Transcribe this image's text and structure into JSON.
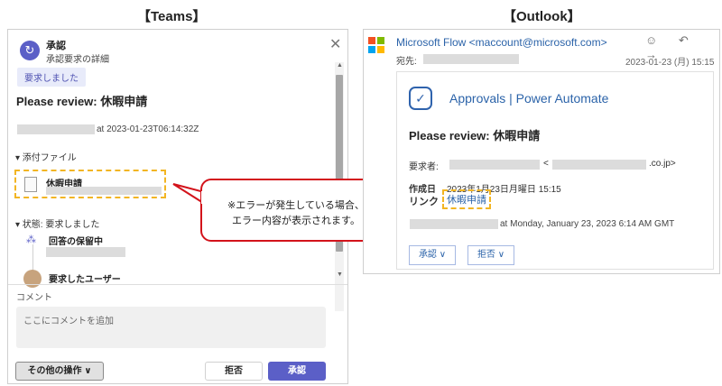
{
  "headings": {
    "teams": "【Teams】",
    "outlook": "【Outlook】"
  },
  "teams": {
    "app_icon": "approval-icon",
    "title": "承認",
    "subtitle": "承認要求の詳細",
    "close": "✕",
    "status_badge": "要求しました",
    "review_title": "Please review: 休暇申請",
    "timestamp": "at 2023-01-23T06:14:32Z",
    "attachments_header": "▾ 添付ファイル",
    "attachment_name": "休暇申請",
    "status_header": "▾ 状態: 要求しました",
    "pending_label": "回答の保留中",
    "requester_label": "要求したユーザー",
    "comment_label": "コメント",
    "comment_placeholder": "ここにコメントを追加",
    "other_actions": "その他の操作 ∨",
    "reject": "拒否",
    "approve": "承認",
    "accent_color": "#5b5fc7"
  },
  "callout": {
    "line1": "※エラーが発生している場合、",
    "line2": "エラー内容が表示されます。",
    "border_color": "#d3131b"
  },
  "outlook": {
    "from": "Microsoft Flow <maccount@microsoft.com>",
    "to_label": "宛先:",
    "date": "2023-01-23 (月) 15:15",
    "action_icons": "☺ ↶ →",
    "app_title": "Approvals | Power Automate",
    "review_title": "Please review: 休暇申請",
    "requester_label": "要求者:",
    "email_open": "<",
    "email_domain": ".co.jp>",
    "created_label": "作成日",
    "created_value": "2023年1月23日月曜日 15:15",
    "link_label": "リンク",
    "link_text": "休暇申請",
    "sent_text": "at Monday, January 23, 2023 6:14 AM GMT",
    "approve_btn": "承認 ∨",
    "reject_btn": "拒否 ∨",
    "link_color": "#2b63a9",
    "highlight_color": "#f2b523"
  }
}
